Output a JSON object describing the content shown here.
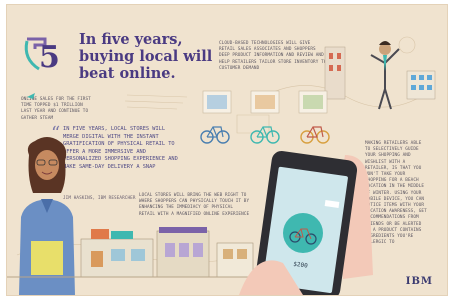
{
  "poster": {
    "badge_number": "5",
    "title": "In five years, buying local will beat online.",
    "stat_text": "Online sales for the first time topped $1 trillion last year and continue to gather steam",
    "quote": "In five years, local stores will merge digital with the instant gratification of physical retail to offer a more immersive and personalized shopping experience and make same-day delivery a snap",
    "attribution": "Jim Haskins, IBM Researcher",
    "stores_text": "Local stores will bring the Web right to where shoppers can physically touch it by enhancing the immediacy of physical retail with a magnified online experience",
    "cloud_text": "Cloud-based technologies will give retail sales associates and shoppers deep product information and review and help retailers tailor store inventory to customer demand",
    "mobile_text": "Making retailers able to selectively guide your shopping and wishlist with a retailer, is that you won't take your shopping for a beach vacation in the middle of winter. Using your mobile device, you can notice items with your location awareness, get recommendations from friends or be alerted if a product contains ingredients you're allergic to",
    "phone_price": "$200",
    "logo": "IBM"
  },
  "colors": {
    "background": "#f0e3cf",
    "title": "#4a3a82",
    "accent_teal": "#3fb8b0",
    "accent_purple": "#7a62a8",
    "phone_body": "#2e2e33"
  },
  "icons": [
    "number-five-badge",
    "woman-researcher",
    "man-presenter",
    "bicycle-icon",
    "smartphone",
    "storefront",
    "bird-icon",
    "city-building"
  ]
}
